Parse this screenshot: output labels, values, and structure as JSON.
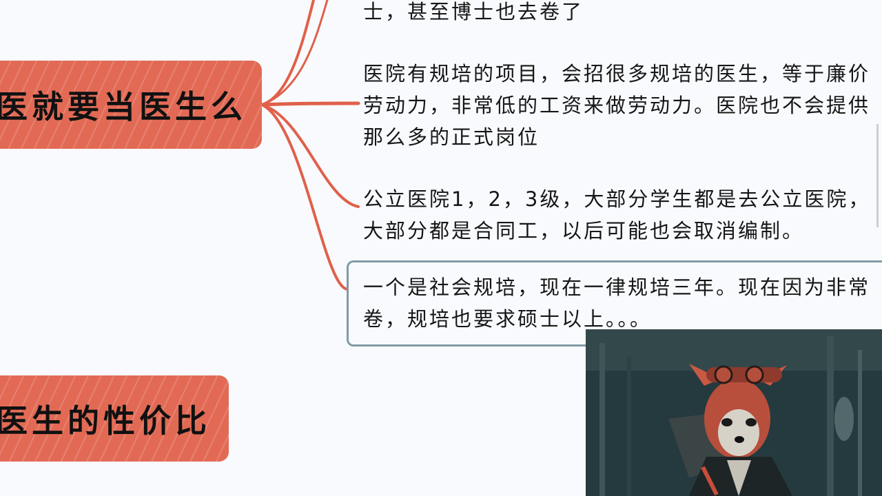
{
  "mindmap": {
    "topics": [
      {
        "label": "医就要当医生么"
      },
      {
        "label": "医生的性价比"
      }
    ],
    "notes": [
      {
        "lines": [
          "士，甚至博士也去卷了"
        ]
      },
      {
        "lines": [
          "医院有规培的项目，会招很多规培的医生，等于廉价",
          "劳动力，非常低的工资来做劳动力。医院也不会提供",
          "那么多的正式岗位"
        ]
      },
      {
        "lines": [
          "公立医院1，2，3级，大部分学生都是去公立医院，",
          "大部分都是合同工，以后可能也会取消编制。"
        ]
      },
      {
        "lines": [
          "一个是社会规培，现在一律规培三年。现在因为非常",
          "卷，规培也要求硕士以上。。。"
        ]
      }
    ]
  },
  "colors": {
    "topic_fill": "#e26a55",
    "connector": "#e0604a",
    "selected_border": "#7f9ba5",
    "background": "#f8fafd"
  },
  "overlay": {
    "image": "red-panda-illustration"
  }
}
